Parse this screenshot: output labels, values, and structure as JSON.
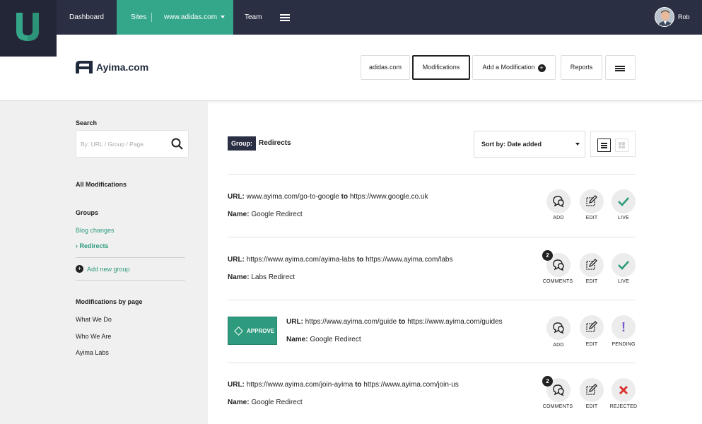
{
  "topnav": {
    "dashboard": "Dashboard",
    "sites": "Sites",
    "site_select": "www.adidas.com",
    "team": "Team",
    "user_name": "Rob"
  },
  "header": {
    "brand": "Ayima.com",
    "buttons": {
      "site": "adidas.com",
      "modifications": "Modifications",
      "add_modification": "Add a Modification",
      "reports": "Reports"
    }
  },
  "sidebar": {
    "search_label": "Search",
    "search_placeholder": "By: URL / Group / Page",
    "all_modifications": "All Modifications",
    "groups_heading": "Groups",
    "groups": [
      "Blog changes",
      "Redirects"
    ],
    "add_group": "Add new group",
    "by_page_heading": "Modifications by page",
    "pages": [
      "What We Do",
      "Who We Are",
      "Ayima Labs"
    ]
  },
  "main": {
    "group_tag": "Group:",
    "group_name": "Redirects",
    "sort_label": "Sort by: Date added",
    "url_label": "URL:",
    "to_label": "to",
    "name_label": "Name:",
    "approve_label": "APPROVE",
    "modifications": [
      {
        "from": "www.ayima.com/go-to-google",
        "to": "https://www.google.co.uk",
        "name": "Google Redirect",
        "comment_label": "ADD",
        "comment_count": "",
        "edit_label": "EDIT",
        "status": "LIVE"
      },
      {
        "from": "https://www.ayima.com/ayima-labs",
        "to": "https://www.ayima.com/labs",
        "name": "Labs Redirect",
        "comment_label": "COMMENTS",
        "comment_count": "2",
        "edit_label": "EDIT",
        "status": "LIVE"
      },
      {
        "from": "https://www.ayima.com/guide",
        "to": "https://www.ayima.com/guides",
        "name": "Google Redirect",
        "comment_label": "ADD",
        "comment_count": "",
        "edit_label": "EDIT",
        "status": "PENDING"
      },
      {
        "from": "https://www.ayima.com/join-ayima",
        "to": "https://www.ayima.com/join-us",
        "name": "Google Redirect",
        "comment_label": "COMMENTS",
        "comment_count": "2",
        "edit_label": "EDIT",
        "status": "REJECTED"
      }
    ]
  },
  "colors": {
    "nav_bg": "#2b2f43",
    "accent_green": "#34a78a",
    "live_check": "#2e9b7e",
    "pending": "#7b55c9",
    "rejected": "#d9302a"
  }
}
